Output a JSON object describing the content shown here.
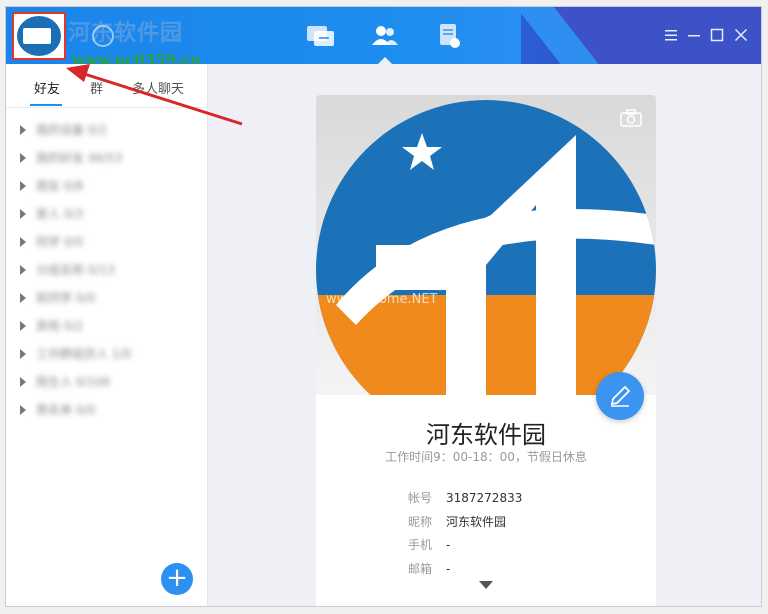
{
  "app": {
    "watermark_text": "河东软件园",
    "watermark_url": "www.pc0359.cn",
    "banner_watermark": "www.pHome.NET"
  },
  "titlebar": {
    "nav": [
      {
        "name": "messages",
        "icon": "chat-icon"
      },
      {
        "name": "contacts",
        "icon": "contacts-icon",
        "active": true
      },
      {
        "name": "notes",
        "icon": "notes-icon"
      }
    ],
    "controls": [
      "menu-icon",
      "minimize-icon",
      "maximize-icon",
      "close-icon"
    ]
  },
  "tabs": [
    {
      "label": "好友",
      "active": true
    },
    {
      "label": "群"
    },
    {
      "label": "多人聊天"
    }
  ],
  "groups": [
    {
      "label": "我的设备 0/2"
    },
    {
      "label": "我的好友 46/53"
    },
    {
      "label": "朋友 0/8"
    },
    {
      "label": "家人 0/3"
    },
    {
      "label": "同学 0/0"
    },
    {
      "label": "分组名称 0/13"
    },
    {
      "label": "前同学 0/0"
    },
    {
      "label": "其他 0/2"
    },
    {
      "label": "工作群组员人 1/0"
    },
    {
      "label": "陌生人 0/106"
    },
    {
      "label": "黑名单 0/0"
    }
  ],
  "profile": {
    "name": "河东软件园",
    "subtitle": "工作时间9：00-18：00，节假日休息",
    "fields": [
      {
        "key": "帐号",
        "value": "3187272833"
      },
      {
        "key": "昵称",
        "value": "河东软件园"
      },
      {
        "key": "手机",
        "value": "-"
      },
      {
        "key": "邮箱",
        "value": "-"
      }
    ]
  },
  "colors": {
    "accent": "#1e8ef0",
    "logo_blue": "#1b72b8",
    "logo_orange": "#f08a1c",
    "highlight_red": "#e0362c"
  }
}
